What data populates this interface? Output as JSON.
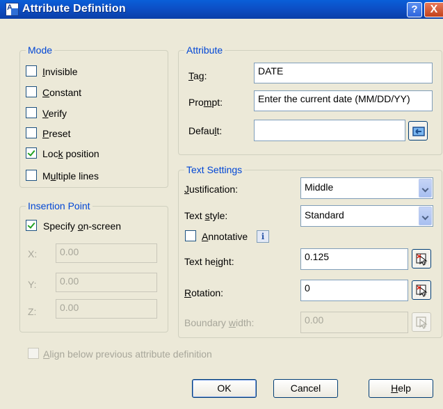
{
  "window": {
    "title": "Attribute Definition",
    "help_glyph": "?",
    "close_glyph": "X"
  },
  "mode": {
    "title": "Mode",
    "items": [
      {
        "pre": "",
        "u": "I",
        "post": "nvisible",
        "checked": false
      },
      {
        "pre": "",
        "u": "C",
        "post": "onstant",
        "checked": false
      },
      {
        "pre": "",
        "u": "V",
        "post": "erify",
        "checked": false
      },
      {
        "pre": "",
        "u": "P",
        "post": "reset",
        "checked": false
      },
      {
        "pre": "Loc",
        "u": "k",
        "post": " position",
        "checked": true
      },
      {
        "pre": "M",
        "u": "u",
        "post": "ltiple lines",
        "checked": false
      }
    ]
  },
  "insertion": {
    "title": "Insertion Point",
    "specify": {
      "pre": "Specify ",
      "u": "o",
      "post": "n-screen",
      "checked": true
    },
    "x": {
      "label": "X:",
      "value": "0.00"
    },
    "y": {
      "label": "Y:",
      "value": "0.00"
    },
    "z": {
      "label": "Z:",
      "value": "0.00"
    }
  },
  "attribute": {
    "title": "Attribute",
    "tag": {
      "pre": "",
      "u": "T",
      "post": "ag:",
      "value": "DATE"
    },
    "prompt": {
      "pre": "Pro",
      "u": "m",
      "post": "pt:",
      "value": "Enter the current date (MM/DD/YY)"
    },
    "default": {
      "pre": "Defau",
      "u": "l",
      "post": "t:",
      "value": ""
    }
  },
  "text_settings": {
    "title": "Text Settings",
    "justification": {
      "pre": "",
      "u": "J",
      "post": "ustification:",
      "value": "Middle"
    },
    "text_style": {
      "pre": "Text ",
      "u": "s",
      "post": "tyle:",
      "value": "Standard"
    },
    "annotative": {
      "pre": "",
      "u": "A",
      "post": "nnotative",
      "checked": false,
      "info_glyph": "i"
    },
    "text_height": {
      "pre": "Text he",
      "u": "i",
      "post": "ght:",
      "value": "0.125"
    },
    "rotation": {
      "pre": "",
      "u": "R",
      "post": "otation:",
      "value": "0"
    },
    "boundary_width": {
      "pre": "Boundary ",
      "u": "w",
      "post": "idth:",
      "value": "0.00"
    }
  },
  "align_below": {
    "pre": "",
    "u": "A",
    "post": "lign below previous attribute definition",
    "checked": false
  },
  "buttons": {
    "ok": "OK",
    "cancel": "Cancel",
    "help": {
      "pre": "",
      "u": "H",
      "post": "elp"
    }
  }
}
